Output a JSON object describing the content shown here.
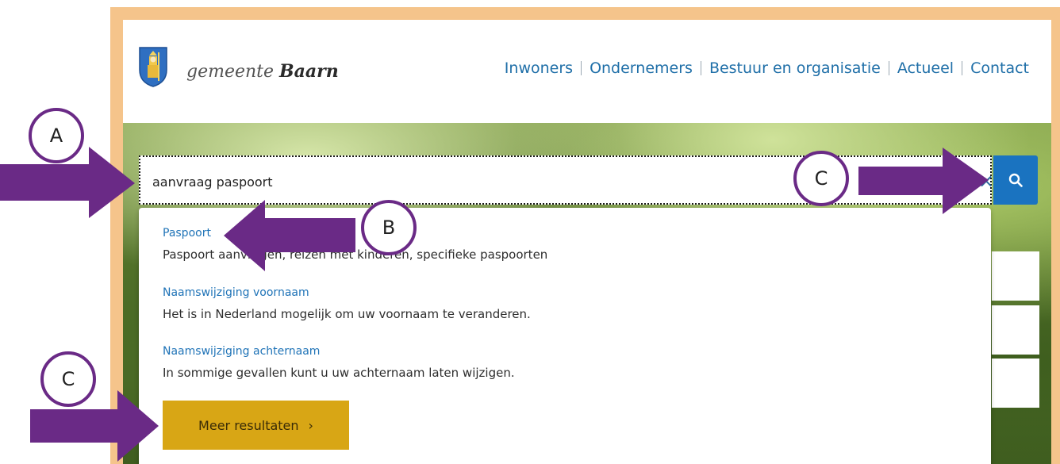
{
  "header": {
    "logo_prefix": "gemeente",
    "logo_name": "Baarn",
    "nav": [
      "Inwoners",
      "Ondernemers",
      "Bestuur en organisatie",
      "Actueel",
      "Contact"
    ]
  },
  "search": {
    "value": "aanvraag paspoort",
    "clear_icon": "×",
    "button_icon": "search-icon"
  },
  "results": [
    {
      "title": "Paspoort",
      "description": "Paspoort aanvragen, reizen met kinderen, specifieke paspoorten"
    },
    {
      "title": "Naamswijziging voornaam",
      "description": "Het is in Nederland mogelijk om uw voornaam te veranderen."
    },
    {
      "title": "Naamswijziging achternaam",
      "description": "In sommige gevallen kunt u uw achternaam laten wijzigen."
    }
  ],
  "more_results": {
    "label": "Meer resultaten",
    "chevron": "›"
  },
  "annotations": {
    "a": "A",
    "b": "B",
    "c_top": "C",
    "c_bottom": "C"
  },
  "colors": {
    "frame": "#f5c48b",
    "link": "#1f73b7",
    "search_button": "#1a73c0",
    "more_button": "#d8a615",
    "annotation": "#6a2a86"
  }
}
